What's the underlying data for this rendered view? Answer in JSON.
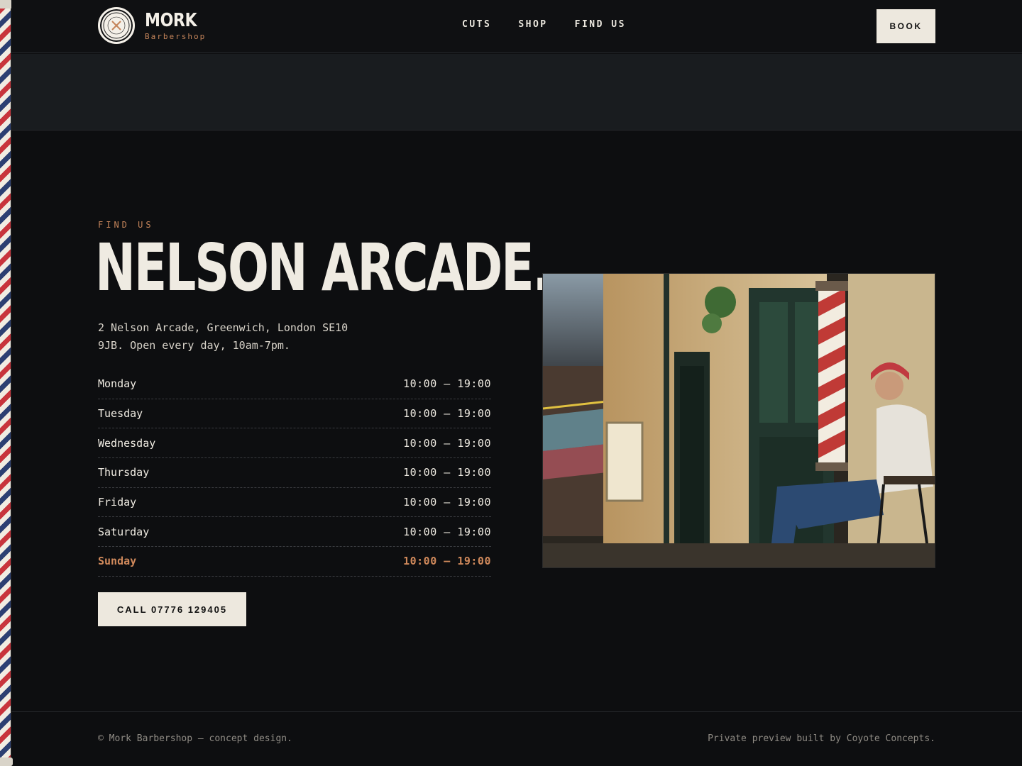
{
  "brand": {
    "name": "MORK",
    "subtitle": "Barbershop"
  },
  "nav": {
    "items": [
      "CUTS",
      "SHOP",
      "FIND US"
    ],
    "book_label": "BOOK"
  },
  "find_us": {
    "eyebrow": "FIND US",
    "title": "NELSON ARCADE.",
    "address_line1": "2 Nelson Arcade, Greenwich, London SE10",
    "address_line2": "9JB. Open every day, 10am-7pm.",
    "hours": [
      {
        "day": "Monday",
        "time": "10:00 – 19:00"
      },
      {
        "day": "Tuesday",
        "time": "10:00 – 19:00"
      },
      {
        "day": "Wednesday",
        "time": "10:00 – 19:00"
      },
      {
        "day": "Thursday",
        "time": "10:00 – 19:00"
      },
      {
        "day": "Friday",
        "time": "10:00 – 19:00"
      },
      {
        "day": "Saturday",
        "time": "10:00 – 19:00"
      },
      {
        "day": "Sunday",
        "time": "10:00 – 19:00"
      }
    ],
    "call_label": "CALL 07776 129405"
  },
  "footer": {
    "left": "© Mork Barbershop — concept design.",
    "right": "Private preview built by Coyote Concepts."
  },
  "colors": {
    "accent": "#c4845a",
    "background": "#0d0e10",
    "button_bg": "#ede8de"
  }
}
